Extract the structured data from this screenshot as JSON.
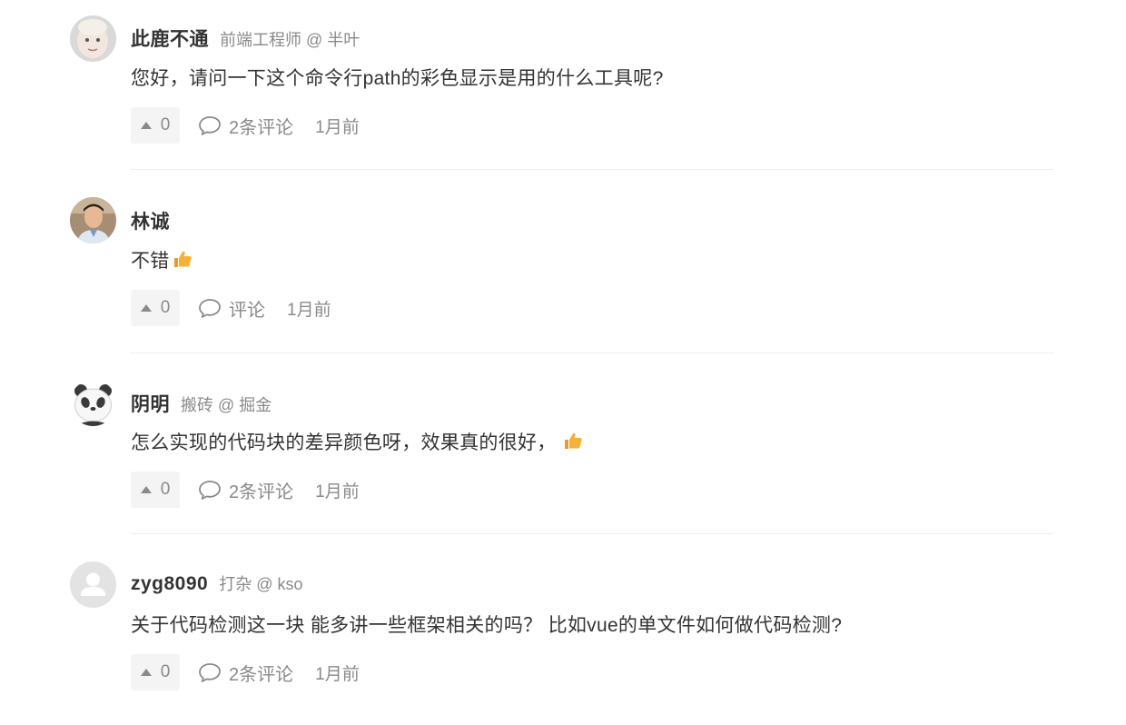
{
  "comments": [
    {
      "username": "此鹿不通",
      "meta": "前端工程师 @ 半叶",
      "content": "您好，请问一下这个命令行path的彩色显示是用的什么工具呢?",
      "likes": "0",
      "comment_label": "2条评论",
      "time": "1月前",
      "avatar": "baby-photo-avatar"
    },
    {
      "username": "林诚",
      "meta": "",
      "content": "不错",
      "emoji": "thumbs-up-icon",
      "likes": "0",
      "comment_label": "评论",
      "time": "1月前",
      "avatar": "man-photo-avatar"
    },
    {
      "username": "阴明",
      "meta": "搬砖 @ 掘金",
      "content": "怎么实现的代码块的差异颜色呀，效果真的很好，",
      "emoji": "thumbs-up-icon",
      "likes": "0",
      "comment_label": "2条评论",
      "time": "1月前",
      "avatar": "panda-avatar"
    },
    {
      "username": "zyg8090",
      "meta": "打杂 @ kso",
      "content": "关于代码检测这一块 能多讲一些框架相关的吗？ 比如vue的单文件如何做代码检测?",
      "likes": "0",
      "comment_label": "2条评论",
      "time": "1月前",
      "avatar": "default-user-avatar"
    }
  ],
  "colors": {
    "text": "#333333",
    "muted": "#8a8a8a",
    "button_bg": "#f4f4f4",
    "divider": "#ececec",
    "emoji": "#f5b23a"
  }
}
